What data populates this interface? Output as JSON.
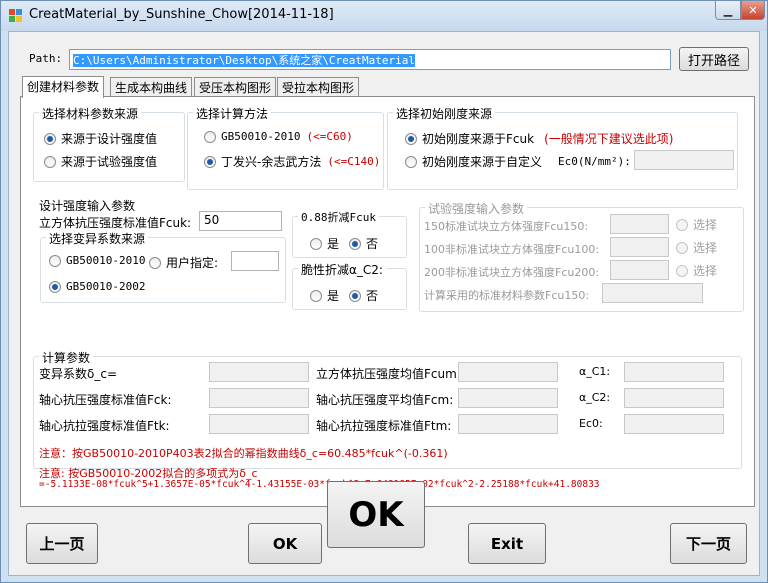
{
  "window": {
    "title": "CreatMaterial_by_Sunshine_Chow[2014-11-18]"
  },
  "path": {
    "label": "Path:",
    "value": "C:\\Users\\Administrator\\Desktop\\系统之家\\CreatMaterial",
    "open_button": "打开路径"
  },
  "tabs": [
    "创建材料参数",
    "生成本构曲线",
    "受压本构图形",
    "受拉本构图形"
  ],
  "source_group": {
    "title": "选择材料参数来源",
    "options": [
      "来源于设计强度值",
      "来源于试验强度值"
    ],
    "selected": 0
  },
  "method_group": {
    "title": "选择计算方法",
    "options": [
      "GB50010-2010",
      "丁发兴-余志武方法"
    ],
    "notes": [
      "(<=C60)",
      "(<=C140)"
    ],
    "selected": 1
  },
  "stiffness_group": {
    "title": "选择初始刚度来源",
    "options": [
      "初始刚度来源于Fcuk",
      "初始刚度来源于自定义"
    ],
    "note": "(一般情况下建议选此项)",
    "ec0_label": "Ec0(N/mm²):",
    "selected": 0
  },
  "design": {
    "title": "设计强度输入参数",
    "fcuk_label": "立方体抗压强度标准值Fcuk:",
    "fcuk_value": "50",
    "variation_title": "选择变异系数来源",
    "variation_options": [
      "GB50010-2010",
      "用户指定:",
      "GB50010-2002"
    ],
    "variation_selected": 2,
    "reduce088_title": "0.88折减Fcuk",
    "brittle_title": "脆性折减α_C2:",
    "yes": "是",
    "no": "否"
  },
  "test": {
    "title": "试验强度输入参数",
    "rows": [
      "150标准试块立方体强度Fcu150:",
      "100非标准试块立方体强度Fcu100:",
      "200非标准试块立方体强度Fcu200:"
    ],
    "select_label": "选择",
    "computed_label": "计算采用的标准材料参数Fcu150:"
  },
  "calc": {
    "title": "计算参数",
    "col1": [
      "变异系数δ_c=",
      "轴心抗压强度标准值Fck:",
      "轴心抗拉强度标准值Ftk:"
    ],
    "col2": [
      "立方体抗压强度均值Fcum:",
      "轴心抗压强度平均值Fcm:",
      "轴心抗拉强度标准值Ftm:"
    ],
    "col3": [
      "α_C1:",
      "α_C2:",
      "Ec0:"
    ],
    "note1": "注意：按GB50010-2010P403表2拟合的幂指数曲线δ_c=60.485*fcuk^(-0.361)",
    "note2a": "注意: 按GB50010-2002拟合的多项式为δ_c",
    "note2b": "=-5.1133E-08*fcuk^5+1.3657E-05*fcuk^4-1.43155E-03*fcuk^3+7.648185E-02*fcuk^2-2.25188*fcuk+41.80833"
  },
  "buttons": {
    "prev": "上一页",
    "ok_small": "OK",
    "ok_big": "OK",
    "exit": "Exit",
    "next": "下一页"
  },
  "colors": {
    "accent_red": "#c80000",
    "selection_blue": "#3399ff"
  }
}
